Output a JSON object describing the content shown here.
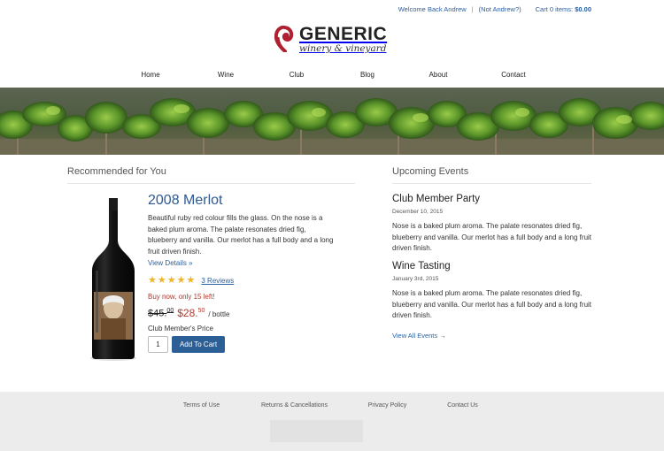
{
  "topbar": {
    "welcome": "Welcome Back Andrew",
    "separator": "|",
    "not_user": "(Not Andrew?)",
    "cart_label": "Cart 0 items:",
    "cart_total": "$0.00"
  },
  "logo": {
    "brand": "GENERIC",
    "tagline": "winery & vineyard",
    "icon": "grape-swirl-icon"
  },
  "nav": {
    "items": [
      "Home",
      "Wine",
      "Club",
      "Blog",
      "About",
      "Contact"
    ]
  },
  "hero": {
    "image": "vineyard-banner"
  },
  "recommended": {
    "heading": "Recommended for You",
    "product": {
      "title": "2008 Merlot",
      "description": "Beautiful ruby red colour fills the glass. On the nose is a baked plum aroma. The palate resonates dried fig, blueberry and vanilla. Our merlot has a full body and a long fruit driven finish.",
      "details_link": "View Details »",
      "rating": 5,
      "reviews": "3 Reviews",
      "stock": "Buy now, only 15 left!",
      "old_price": "$45.",
      "old_cents": "00",
      "new_price": "$28.",
      "new_cents": "50",
      "unit": "/ bottle",
      "member_label": "Club Member's Price",
      "quantity": "1",
      "add_to_cart": "Add To Cart"
    }
  },
  "events": {
    "heading": "Upcoming Events",
    "items": [
      {
        "title": "Club Member Party",
        "date": "December 10, 2015",
        "description": "Nose is a baked plum aroma. The palate resonates dried fig, blueberry and vanilla. Our merlot has a full body and a long fruit driven finish."
      },
      {
        "title": "Wine Tasting",
        "date": "January 3rd, 2015",
        "description": "Nose is a baked plum aroma. The palate resonates dried fig, blueberry and vanilla. Our merlot has a full body and a long fruit driven finish."
      }
    ],
    "view_all": "View All Events →"
  },
  "footer": {
    "links": [
      "Terms of Use",
      "Returns & Cancellations",
      "Privacy Policy",
      "Contact Us"
    ]
  },
  "colors": {
    "link": "#2a5fa0",
    "brand_red": "#b03a2e",
    "button": "#2c5f95",
    "star": "#f0b429"
  }
}
